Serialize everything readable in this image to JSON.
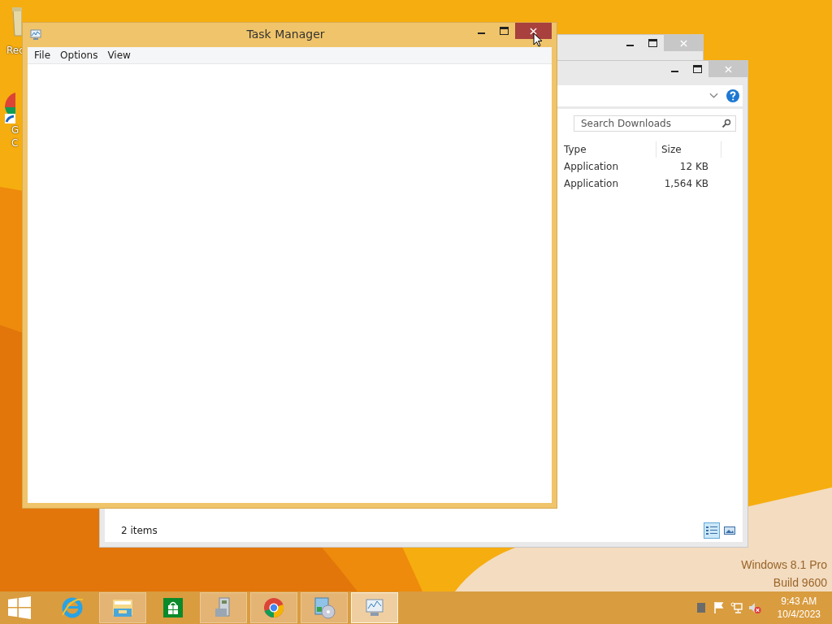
{
  "desktop": {
    "icons": [
      {
        "kind": "bin",
        "lines": [
          "Rec"
        ]
      },
      {
        "kind": "chrome",
        "lines": [
          "G",
          "C"
        ]
      }
    ],
    "watermark": [
      "Windows 8.1 Pro",
      "Build 9600"
    ]
  },
  "explorer": {
    "search": {
      "placeholder": "Search Downloads"
    },
    "columns": [
      "Type",
      "Size"
    ],
    "rows": [
      {
        "type": "Application",
        "size": "12 KB"
      },
      {
        "type": "Application",
        "size": "1,564 KB"
      }
    ],
    "status": "2 items",
    "views": [
      {
        "kind": "details",
        "selected": true
      },
      {
        "kind": "large",
        "selected": false
      }
    ]
  },
  "task_manager": {
    "title": "Task Manager",
    "close_hover": true,
    "menu": [
      "File",
      "Options",
      "View"
    ]
  },
  "taskbar": {
    "apps": [
      {
        "kind": "ie",
        "running": false,
        "selected": false
      },
      {
        "kind": "explorer",
        "running": true,
        "selected": false
      },
      {
        "kind": "store",
        "running": false,
        "selected": false
      },
      {
        "kind": "installer",
        "running": true,
        "selected": false
      },
      {
        "kind": "chrome",
        "running": true,
        "selected": false
      },
      {
        "kind": "disc",
        "running": true,
        "selected": false
      },
      {
        "kind": "taskmgr",
        "running": true,
        "selected": true
      }
    ],
    "tray": [
      {
        "kind": "square"
      },
      {
        "kind": "flag"
      },
      {
        "kind": "network"
      },
      {
        "kind": "volume-muted"
      }
    ],
    "time": "9:43 AM",
    "date": "10/4/2023"
  }
}
